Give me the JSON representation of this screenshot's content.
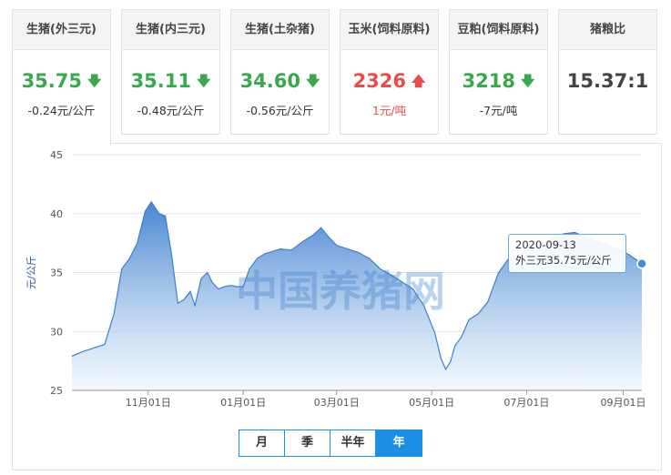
{
  "cards": [
    {
      "title": "生猪(外三元)",
      "value": "35.75",
      "dir": "down",
      "change": "-0.24元/公斤",
      "color": "green",
      "active": true
    },
    {
      "title": "生猪(内三元)",
      "value": "35.11",
      "dir": "down",
      "change": "-0.48元/公斤",
      "color": "green",
      "active": false
    },
    {
      "title": "生猪(土杂猪)",
      "value": "34.60",
      "dir": "down",
      "change": "-0.56元/公斤",
      "color": "green",
      "active": false
    },
    {
      "title": "玉米(饲料原料)",
      "value": "2326",
      "dir": "up",
      "change": "1元/吨",
      "color": "red",
      "active": false
    },
    {
      "title": "豆粕(饲料原料)",
      "value": "3218",
      "dir": "down",
      "change": "-7元/吨",
      "color": "green",
      "active": false
    },
    {
      "title": "猪粮比",
      "value": "15.37:1",
      "dir": "",
      "change": "",
      "color": "dark",
      "active": false
    }
  ],
  "tabs": [
    "月",
    "季",
    "半年",
    "年"
  ],
  "active_tab": "年",
  "watermark": "中国养猪网",
  "tooltip": {
    "date": "2020-09-13",
    "text": "外三元35.75元/公斤"
  },
  "colors": {
    "line": "#3d7fcf",
    "area_top": "#3d7fcf",
    "area_bottom": "#e9f3fc",
    "up": "#e84c4c",
    "down": "#3aa84d",
    "tab_active": "#1a8fe3"
  },
  "chart_data": {
    "type": "area",
    "title": "",
    "ylabel": "元/公斤",
    "xlabel": "",
    "ylim": [
      25,
      45
    ],
    "yticks": [
      25,
      30,
      35,
      40,
      45
    ],
    "xticks": [
      "11月01日",
      "01月01日",
      "03月01日",
      "05月01日",
      "07月01日",
      "09月01日"
    ],
    "xtick_dates": [
      "2019-11-01",
      "2020-01-01",
      "2020-03-01",
      "2020-05-01",
      "2020-07-01",
      "2020-09-01"
    ],
    "xlim": [
      "2019-09-13",
      "2020-09-13"
    ],
    "grid": true,
    "series": [
      {
        "name": "外三元",
        "x": [
          "2019-09-13",
          "2019-09-20",
          "2019-09-27",
          "2019-10-04",
          "2019-10-10",
          "2019-10-15",
          "2019-10-20",
          "2019-10-25",
          "2019-10-30",
          "2019-11-03",
          "2019-11-08",
          "2019-11-12",
          "2019-11-16",
          "2019-11-20",
          "2019-11-24",
          "2019-11-28",
          "2019-12-01",
          "2019-12-05",
          "2019-12-09",
          "2019-12-12",
          "2019-12-16",
          "2019-12-20",
          "2019-12-24",
          "2019-12-28",
          "2020-01-01",
          "2020-01-05",
          "2020-01-10",
          "2020-01-15",
          "2020-01-20",
          "2020-01-25",
          "2020-02-01",
          "2020-02-08",
          "2020-02-15",
          "2020-02-20",
          "2020-02-25",
          "2020-03-01",
          "2020-03-08",
          "2020-03-15",
          "2020-03-22",
          "2020-03-29",
          "2020-04-05",
          "2020-04-12",
          "2020-04-19",
          "2020-04-26",
          "2020-05-03",
          "2020-05-07",
          "2020-05-10",
          "2020-05-13",
          "2020-05-16",
          "2020-05-20",
          "2020-05-25",
          "2020-05-31",
          "2020-06-06",
          "2020-06-13",
          "2020-06-20",
          "2020-06-27",
          "2020-07-04",
          "2020-07-11",
          "2020-07-18",
          "2020-07-25",
          "2020-08-01",
          "2020-08-08",
          "2020-08-15",
          "2020-08-22",
          "2020-08-29",
          "2020-09-05",
          "2020-09-13"
        ],
        "values": [
          27.9,
          28.3,
          28.6,
          28.9,
          31.5,
          35.3,
          36.2,
          37.5,
          40.2,
          41.0,
          40.0,
          39.8,
          36.5,
          32.4,
          32.7,
          33.4,
          32.2,
          34.5,
          35.0,
          34.2,
          33.6,
          33.8,
          33.9,
          33.8,
          33.8,
          35.3,
          36.2,
          36.6,
          36.8,
          37.0,
          36.9,
          37.6,
          38.2,
          38.8,
          38.0,
          37.3,
          37.0,
          36.7,
          36.2,
          35.3,
          34.8,
          34.2,
          33.6,
          32.2,
          29.9,
          27.7,
          26.8,
          27.4,
          28.8,
          29.5,
          31.0,
          31.5,
          32.5,
          35.0,
          36.3,
          36.6,
          37.1,
          37.5,
          38.0,
          38.3,
          38.4,
          38.0,
          37.7,
          37.3,
          37.0,
          36.5,
          35.75
        ]
      }
    ]
  }
}
